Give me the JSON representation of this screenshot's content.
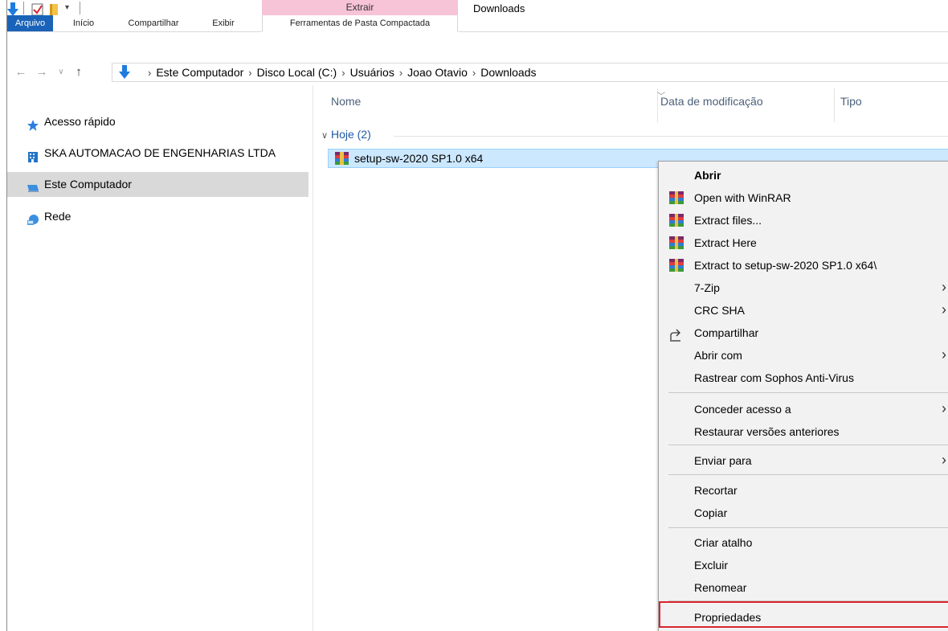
{
  "window": {
    "title": "Downloads"
  },
  "ribbon": {
    "tool_group": "Extrair",
    "tabs": {
      "file": "Arquivo",
      "home": "Início",
      "share": "Compartilhar",
      "view": "Exibir",
      "tools": "Ferramentas de Pasta Compactada"
    }
  },
  "address": {
    "breadcrumbs": [
      "Este Computador",
      "Disco Local (C:)",
      "Usuários",
      "Joao Otavio",
      "Downloads"
    ]
  },
  "sidebar": {
    "items": [
      {
        "label": "Acesso rápido",
        "icon": "star-icon"
      },
      {
        "label": "SKA AUTOMACAO DE ENGENHARIAS LTDA",
        "icon": "building-icon"
      },
      {
        "label": "Este Computador",
        "icon": "computer-icon",
        "selected": true
      },
      {
        "label": "Rede",
        "icon": "network-icon"
      }
    ]
  },
  "content": {
    "columns": {
      "name": "Nome",
      "date": "Data de modificação",
      "type": "Tipo"
    },
    "group_label": "Hoje (2)",
    "file": {
      "name": "setup-sw-2020 SP1.0 x64",
      "icon": "winrar-archive-icon",
      "selected": true
    }
  },
  "context_menu": {
    "items": [
      {
        "label": "Abrir",
        "bold": true
      },
      {
        "label": "Open with WinRAR",
        "icon": "winrar-icon"
      },
      {
        "label": "Extract files...",
        "icon": "winrar-icon"
      },
      {
        "label": "Extract Here",
        "icon": "winrar-icon"
      },
      {
        "label": "Extract to setup-sw-2020 SP1.0 x64\\",
        "icon": "winrar-icon"
      },
      {
        "label": "7-Zip",
        "submenu": true
      },
      {
        "label": "CRC SHA",
        "submenu": true
      },
      {
        "label": "Compartilhar",
        "icon": "share-icon"
      },
      {
        "label": "Abrir com",
        "submenu": true
      },
      {
        "label": "Rastrear com Sophos Anti-Virus"
      },
      {
        "label": "Conceder acesso a",
        "submenu": true
      },
      {
        "label": "Restaurar versões anteriores"
      },
      {
        "label": "Enviar para",
        "submenu": true
      },
      {
        "label": "Recortar"
      },
      {
        "label": "Copiar"
      },
      {
        "label": "Criar atalho"
      },
      {
        "label": "Excluir"
      },
      {
        "label": "Renomear"
      },
      {
        "label": "Propriedades",
        "highlighted": true
      }
    ]
  },
  "colors": {
    "file_tab": "#1a63b8",
    "tool_band": "#f7c3d7",
    "selection": "#cce8ff",
    "highlight_border": "#d9242f"
  }
}
